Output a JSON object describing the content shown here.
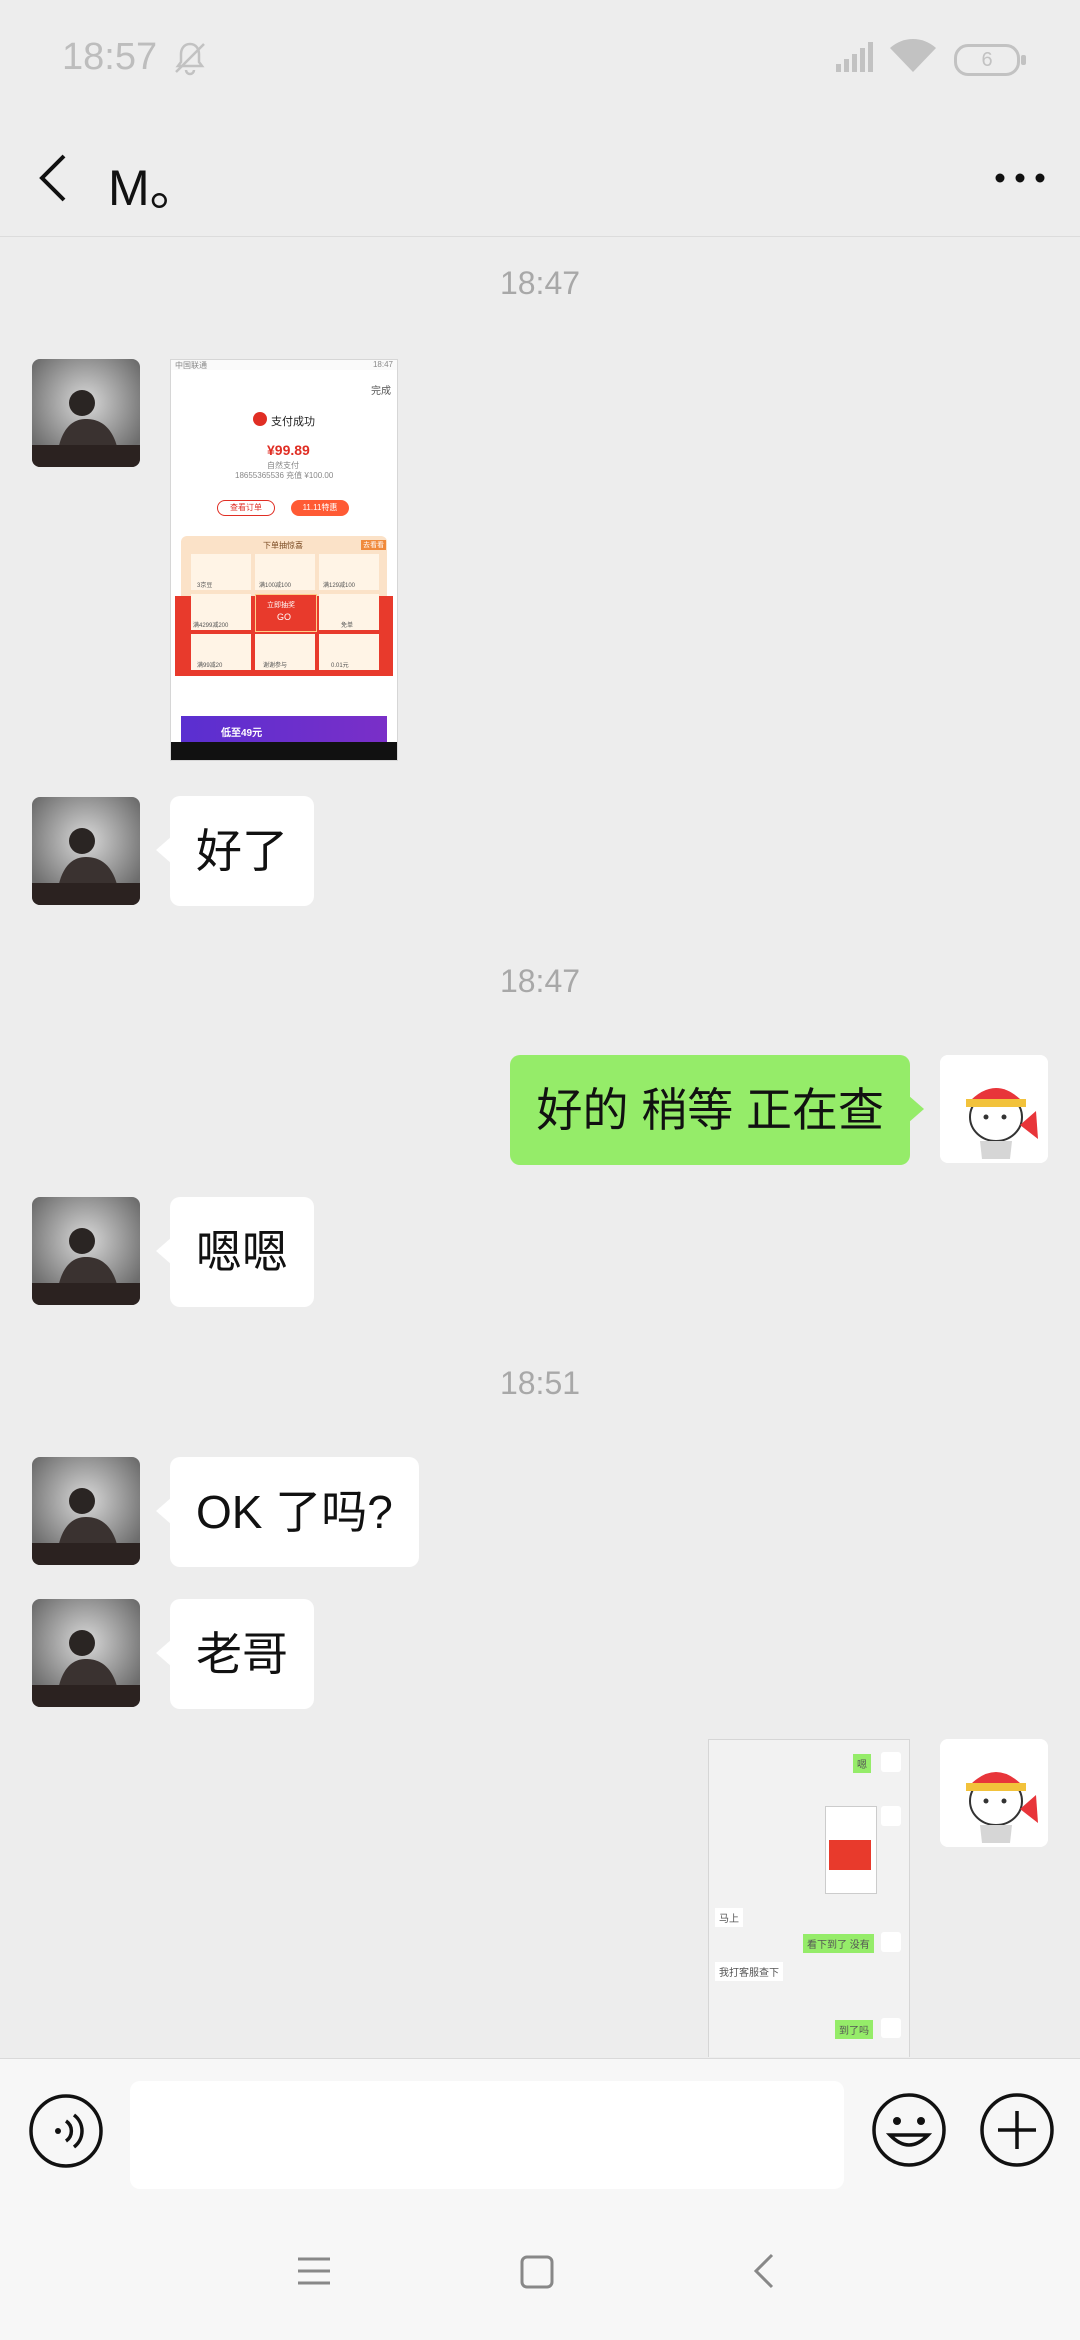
{
  "status_bar": {
    "time": "18:57",
    "battery": "6"
  },
  "header": {
    "title": "M。"
  },
  "messages": {
    "ts1": "18:47",
    "pay_screenshot": {
      "status_text": "中国联通",
      "status_time": "18:47",
      "done": "完成",
      "pay_success": "支付成功",
      "amount": "¥99.89",
      "method": "自然支付",
      "detail": "18655365536 充值 ¥100.00",
      "btn_order": "查看订单",
      "btn_1111": "11.11特惠",
      "lottery_title": "下单抽惊喜",
      "lottery_tag": "去看看",
      "prizes": [
        "3京豆",
        "满100减100",
        "满129减100",
        "满4299减200",
        "免单",
        "满99减20",
        "谢谢参与",
        "0.01元"
      ],
      "center_label": "立即抽奖",
      "center_go": "GO",
      "promo": "低至49元"
    },
    "m1": "好了",
    "ts2": "18:47",
    "m2": "好的 稍等 正在查",
    "m3": "嗯嗯",
    "ts3": "18:51",
    "m4": "OK 了吗?",
    "m5": "老哥",
    "chat_screenshot": {
      "a": "嗯",
      "b": "马上",
      "c": "看下到了 没有",
      "d": "我打客服查下",
      "e": "到了吗"
    }
  },
  "input": {
    "placeholder": ""
  },
  "colors": {
    "sent_bubble": "#95ec69",
    "received_bubble": "#ffffff",
    "background": "#ededed"
  }
}
